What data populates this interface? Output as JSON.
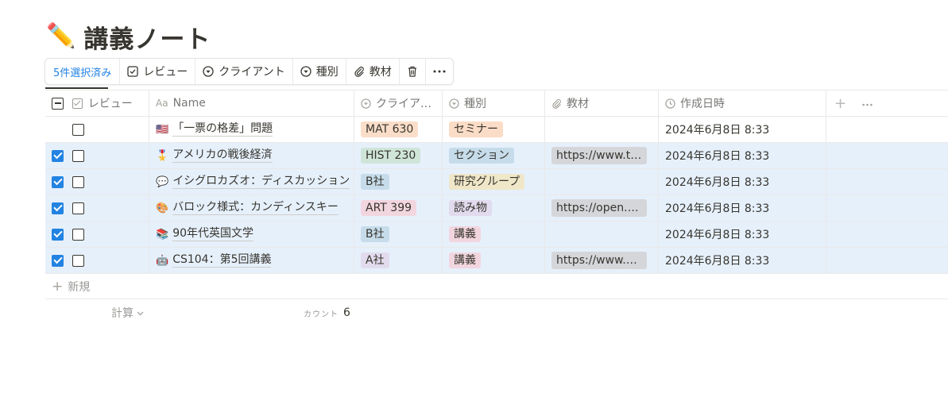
{
  "page": {
    "emoji": "✏️",
    "title": "講義ノート"
  },
  "selection_bar": {
    "count_label": "5件選択済み",
    "review_label": "レビュー",
    "client_label": "クライアント",
    "kind_label": "種別",
    "material_label": "教材"
  },
  "columns": {
    "review": "レビュー",
    "name_prefix": "Aa",
    "name": "Name",
    "client": "クライア…",
    "kind": "種別",
    "material": "教材",
    "created": "作成日時"
  },
  "rows": [
    {
      "selected": false,
      "emoji": "🇺🇸",
      "name": "「一票の格差」問題",
      "client": "MAT 630",
      "client_color": "#fadec9",
      "kind": "セミナー",
      "kind_color": "#fbdcc6",
      "material": "",
      "created": "2024年6月8日 8:33"
    },
    {
      "selected": true,
      "emoji": "🎖️",
      "name": "アメリカの戦後経済",
      "client": "HIST 230",
      "client_color": "#cfe5d9",
      "kind": "セクション",
      "kind_color": "#c6dcea",
      "material": "https://www.th...",
      "created": "2024年6月8日 8:33"
    },
    {
      "selected": true,
      "emoji": "💬",
      "name": "イシグロカズオ：ディスカッション",
      "client": "B社",
      "client_color": "#c6dcea",
      "kind": "研究グループ",
      "kind_color": "#f0e7c9",
      "material": "",
      "created": "2024年6月8日 8:33"
    },
    {
      "selected": true,
      "emoji": "🎨",
      "name": "バロック様式：カンディンスキー",
      "client": "ART 399",
      "client_color": "#f2d6df",
      "kind": "読み物",
      "kind_color": "#e2dbee",
      "material": "https://open.s...",
      "created": "2024年6月8日 8:33"
    },
    {
      "selected": true,
      "emoji": "📚",
      "name": "90年代英国文学",
      "client": "B社",
      "client_color": "#c6dcea",
      "kind": "講義",
      "kind_color": "#f2d6df",
      "material": "",
      "created": "2024年6月8日 8:33"
    },
    {
      "selected": true,
      "emoji": "🤖",
      "name": "CS104：第5回講義",
      "client": "A社",
      "client_color": "#e2dbee",
      "kind": "講義",
      "kind_color": "#f2d6df",
      "material": "https://www.ge...",
      "created": "2024年6月8日 8:33"
    }
  ],
  "new_row_label": "新規",
  "footer": {
    "calc_label": "計算",
    "count_label": "カウント",
    "count_value": "6"
  }
}
